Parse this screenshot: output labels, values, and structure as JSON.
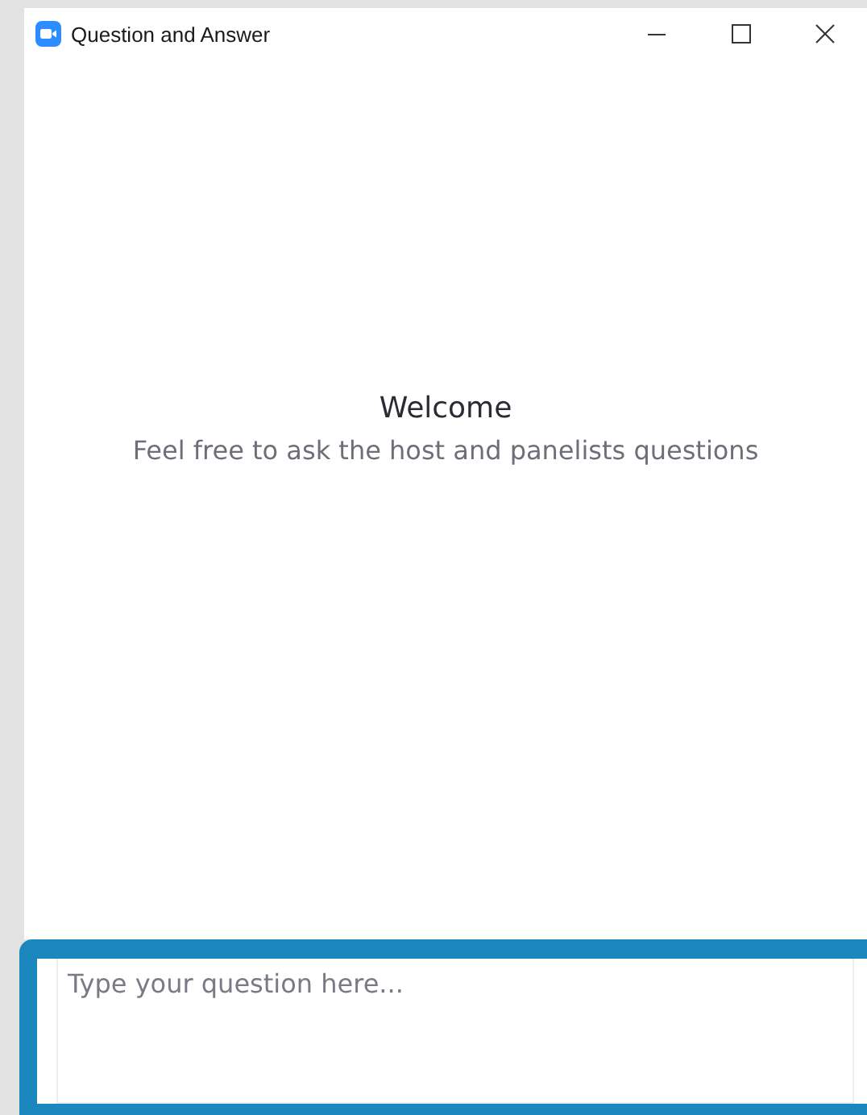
{
  "window": {
    "title": "Question and Answer"
  },
  "welcome": {
    "heading": "Welcome",
    "subtitle": "Feel free to ask the host and panelists questions"
  },
  "question_input": {
    "placeholder": "Type your question here..."
  }
}
